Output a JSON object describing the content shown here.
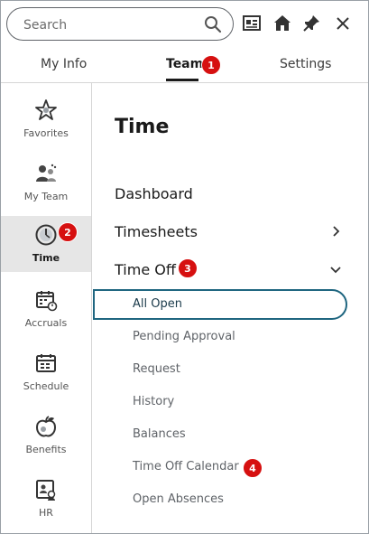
{
  "search": {
    "placeholder": "Search"
  },
  "header_icons": [
    "preview-icon",
    "home-icon",
    "pin-icon",
    "close-icon"
  ],
  "tabs": [
    {
      "label": "My Info",
      "active": false
    },
    {
      "label": "Team",
      "active": true
    },
    {
      "label": "Settings",
      "active": false
    }
  ],
  "rail": {
    "items": [
      {
        "label": "Favorites",
        "icon": "star-icon",
        "active": false
      },
      {
        "label": "My Team",
        "icon": "team-icon",
        "active": false
      },
      {
        "label": "Time",
        "icon": "clock-icon",
        "active": true
      },
      {
        "label": "Accruals",
        "icon": "accruals-calendar-icon",
        "active": false
      },
      {
        "label": "Schedule",
        "icon": "schedule-calendar-icon",
        "active": false
      },
      {
        "label": "Benefits",
        "icon": "apple-icon",
        "active": false
      },
      {
        "label": "HR",
        "icon": "hr-icon",
        "active": false
      }
    ]
  },
  "content": {
    "title": "Time",
    "menu": [
      {
        "label": "Dashboard"
      },
      {
        "label": "Timesheets",
        "chevron": "right"
      },
      {
        "label": "Time Off",
        "chevron": "down",
        "expanded": true
      }
    ],
    "time_off_items": [
      {
        "label": "All Open",
        "selected": true
      },
      {
        "label": "Pending Approval"
      },
      {
        "label": "Request"
      },
      {
        "label": "History"
      },
      {
        "label": "Balances"
      },
      {
        "label": "Time Off Calendar"
      },
      {
        "label": "Open Absences"
      }
    ]
  },
  "badges": [
    "1",
    "2",
    "3",
    "4"
  ],
  "colors": {
    "badge": "#d61010",
    "selected_border": "#1f6680",
    "active_rail_bg": "#e6e6e6"
  }
}
